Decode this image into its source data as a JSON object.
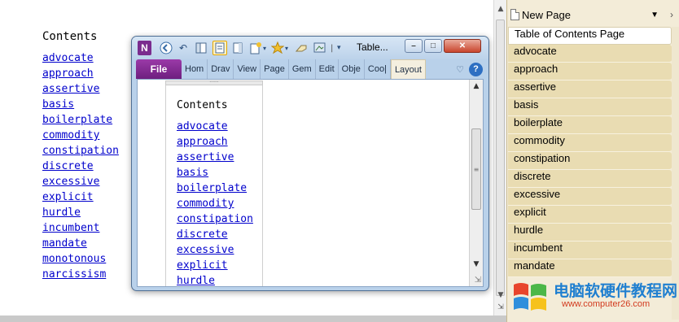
{
  "main_page": {
    "title": "Contents",
    "links": [
      "advocate",
      "approach",
      "assertive",
      "basis",
      "boilerplate",
      "commodity",
      "constipation",
      "discrete",
      "excessive",
      "explicit",
      "hurdle",
      "incumbent",
      "mandate",
      "monotonous",
      "narcissism"
    ]
  },
  "page_tabs": {
    "new_page_label": "New Page",
    "pages": [
      "Table of Contents Page",
      "advocate",
      "approach",
      "assertive",
      "basis",
      "boilerplate",
      "commodity",
      "constipation",
      "discrete",
      "excessive",
      "explicit",
      "hurdle",
      "incumbent",
      "mandate"
    ],
    "selected_index": 0
  },
  "mini_window": {
    "title": "Table...",
    "ribbon_tabs": [
      "File",
      "Hom",
      "Drav",
      "View",
      "Page",
      "Gem",
      "Edit",
      "Obje",
      "Coo|",
      "Layout"
    ],
    "selected_ribbon_tab": "Layout",
    "content_title": "Contents",
    "links": [
      "advocate",
      "approach",
      "assertive",
      "basis",
      "boilerplate",
      "commodity",
      "constipation",
      "discrete",
      "excessive",
      "explicit",
      "hurdle"
    ]
  },
  "watermark": {
    "text": "电脑软硬件教程网",
    "url": "www.computer26.com"
  },
  "colors": {
    "link": "#0000cc",
    "tab_background": "#e9dcb2",
    "file_tab": "#7b2c8e",
    "watermark_text": "#1f7fd0",
    "watermark_url": "#d23a1e"
  },
  "icons": [
    "onenote-logo-icon",
    "back-icon",
    "undo-icon",
    "normal-view-icon",
    "full-page-view-icon",
    "dock-icon",
    "new-page-icon",
    "tag-icon",
    "eraser-icon",
    "screen-clip-icon",
    "customize-qat-icon",
    "help-icon",
    "minimize-ribbon-icon",
    "new-page-dropdown-icon",
    "scroll-up-icon",
    "scroll-down-icon",
    "resize-grip-icon"
  ]
}
